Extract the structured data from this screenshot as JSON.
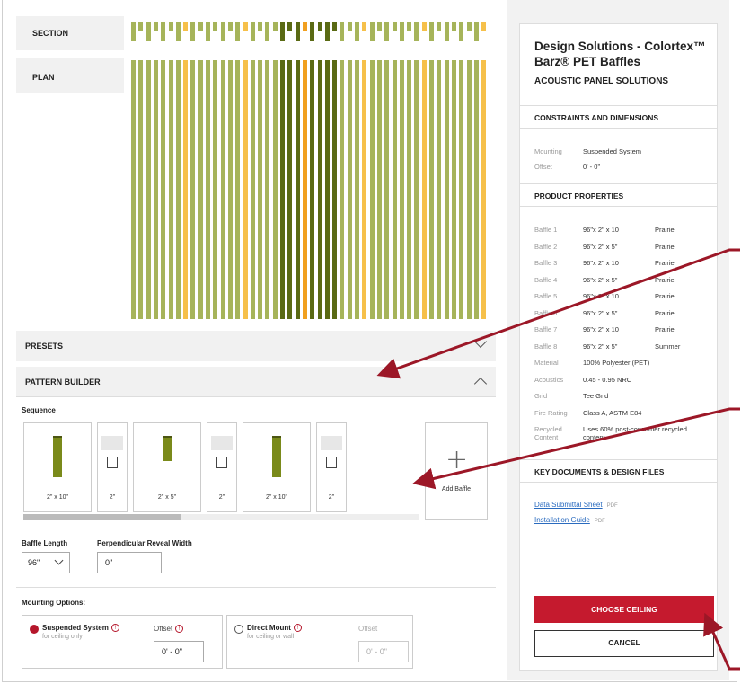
{
  "colors": {
    "prairie": "#a6b45a",
    "summer": "#f6c04a",
    "highlight_dark": "#5a6a14",
    "highlight_accent": "#f1a020",
    "brand_red": "#c51a2e",
    "annotation": "#9c1727"
  },
  "visualizer": {
    "section_label": "SECTION",
    "plan_label": "PLAN"
  },
  "presets": {
    "label": "PRESETS",
    "icon": "chevron-down-icon"
  },
  "pattern_builder": {
    "label": "PATTERN BUILDER",
    "icon": "chevron-up-icon",
    "sequence_label": "Sequence",
    "sequence": [
      {
        "kind": "baffle",
        "caption": "2\" x 10\""
      },
      {
        "kind": "reveal",
        "caption": "2\""
      },
      {
        "kind": "baffle",
        "caption": "2\" x 5\""
      },
      {
        "kind": "reveal",
        "caption": "2\""
      },
      {
        "kind": "baffle",
        "caption": "2\" x 10\""
      },
      {
        "kind": "reveal",
        "caption": "2\""
      }
    ],
    "add_baffle_label": "Add Baffle",
    "scroll_fraction": 0.4,
    "baffle_length_label": "Baffle Length",
    "baffle_length_value": "96\"",
    "reveal_width_label": "Perpendicular Reveal Width",
    "reveal_width_value": "0\""
  },
  "mounting": {
    "label": "Mounting Options:",
    "suspended": {
      "title": "Suspended System",
      "subtitle": "for ceiling only",
      "offset_label": "Offset",
      "offset_value": "0' - 0\"",
      "selected": true
    },
    "direct": {
      "title": "Direct Mount",
      "subtitle": "for ceiling or wall",
      "offset_label": "Offset",
      "offset_value": "0' - 0\"",
      "selected": false
    }
  },
  "panel": {
    "title": "Design Solutions - Colortex™ Barz® PET Baffles",
    "subtitle": "ACOUSTIC PANEL SOLUTIONS",
    "constraints_header": "CONSTRAINTS AND DIMENSIONS",
    "constraints": [
      {
        "k": "Mounting",
        "v": "Suspended System"
      },
      {
        "k": "Offset",
        "v": "0' - 0\""
      }
    ],
    "properties_header": "PRODUCT PROPERTIES",
    "properties": [
      {
        "k": "Baffle 1",
        "v": "96\"x 2\" x 10",
        "v2": "Prairie"
      },
      {
        "k": "Baffle 2",
        "v": "96\"x 2\" x 5\"",
        "v2": "Prairie"
      },
      {
        "k": "Baffle 3",
        "v": "96\"x 2\" x 10",
        "v2": "Prairie"
      },
      {
        "k": "Baffle 4",
        "v": "96\"x 2\" x 5\"",
        "v2": "Prairie"
      },
      {
        "k": "Baffle 5",
        "v": "96\"x 2\" x 10",
        "v2": "Prairie"
      },
      {
        "k": "Baffle 6",
        "v": "96\"x 2\" x 5\"",
        "v2": "Prairie"
      },
      {
        "k": "Baffle 7",
        "v": "96\"x 2\" x 10",
        "v2": "Prairie"
      },
      {
        "k": "Baffle 8",
        "v": "96\"x 2\" x 5\"",
        "v2": "Summer"
      },
      {
        "k": "Material",
        "v": "100% Polyester (PET)",
        "v2": ""
      },
      {
        "k": "Acoustics",
        "v": "0.45 - 0.95 NRC",
        "v2": ""
      },
      {
        "k": "Grid",
        "v": "Tee Grid",
        "v2": ""
      },
      {
        "k": "Fire Rating",
        "v": "Class A, ASTM E84",
        "v2": ""
      },
      {
        "k": "Recycled Content",
        "v": "Uses 60% post-consumer recycled content",
        "v2": ""
      }
    ],
    "docs_header": "KEY DOCUMENTS & DESIGN FILES",
    "docs": [
      {
        "label": "Data Submittal Sheet",
        "format": "PDF"
      },
      {
        "label": "Installation Guide",
        "format": "PDF"
      }
    ],
    "choose_label": "CHOOSE CEILING",
    "cancel_label": "CANCEL"
  }
}
